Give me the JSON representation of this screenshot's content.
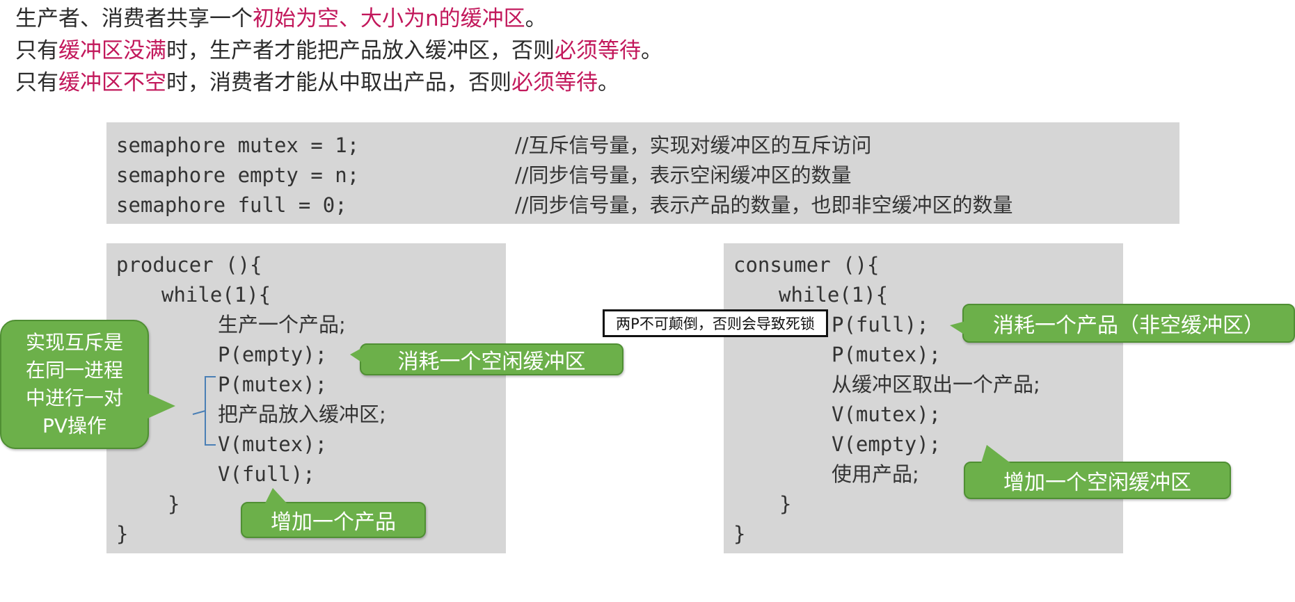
{
  "intro": {
    "line1": [
      "生产者、消费者共享一个",
      "初始为空、大小为n的缓冲区",
      "。"
    ],
    "line2": [
      "只有",
      "缓冲区没满",
      "时，生产者才能把产品放入缓冲区，否则",
      "必须等待",
      "。"
    ],
    "line3": [
      "只有",
      "缓冲区不空",
      "时，消费者才能从中取出产品，否则",
      "必须等待",
      "。"
    ]
  },
  "semaphores": [
    {
      "code": "semaphore mutex = 1;",
      "comment": "//互斥信号量，实现对缓冲区的互斥访问"
    },
    {
      "code": "semaphore empty = n;",
      "comment": "//同步信号量，表示空闲缓冲区的数量"
    },
    {
      "code": "semaphore full = 0;",
      "comment": "//同步信号量，表示产品的数量，也即非空缓冲区的数量"
    }
  ],
  "producer": {
    "header": "producer (){",
    "loop": "while(1){",
    "body": [
      "生产一个产品;",
      "P(empty);",
      "P(mutex);",
      "把产品放入缓冲区;",
      "V(mutex);",
      "V(full);"
    ],
    "loop_close": "}",
    "close": "}"
  },
  "consumer": {
    "header": "consumer (){",
    "loop": "while(1){",
    "body": [
      "P(full);",
      "P(mutex);",
      "从缓冲区取出一个产品;",
      "V(mutex);",
      "V(empty);",
      "使用产品;"
    ],
    "loop_close": "}",
    "close": "}"
  },
  "bubbles": {
    "mutex_note": "实现互斥是\n在同一进程\n中进行一对\nPV操作",
    "consume_empty": "消耗一个空闲缓冲区",
    "add_product": "增加一个产品",
    "consume_product": "消耗一个产品（非空缓冲区）",
    "add_empty": "增加一个空闲缓冲区"
  },
  "warning": "两P不可颠倒，否则会导致死锁",
  "colors": {
    "highlight": "#c2185b",
    "bubble": "#6cb04a",
    "code_bg": "#d6d6d6"
  }
}
